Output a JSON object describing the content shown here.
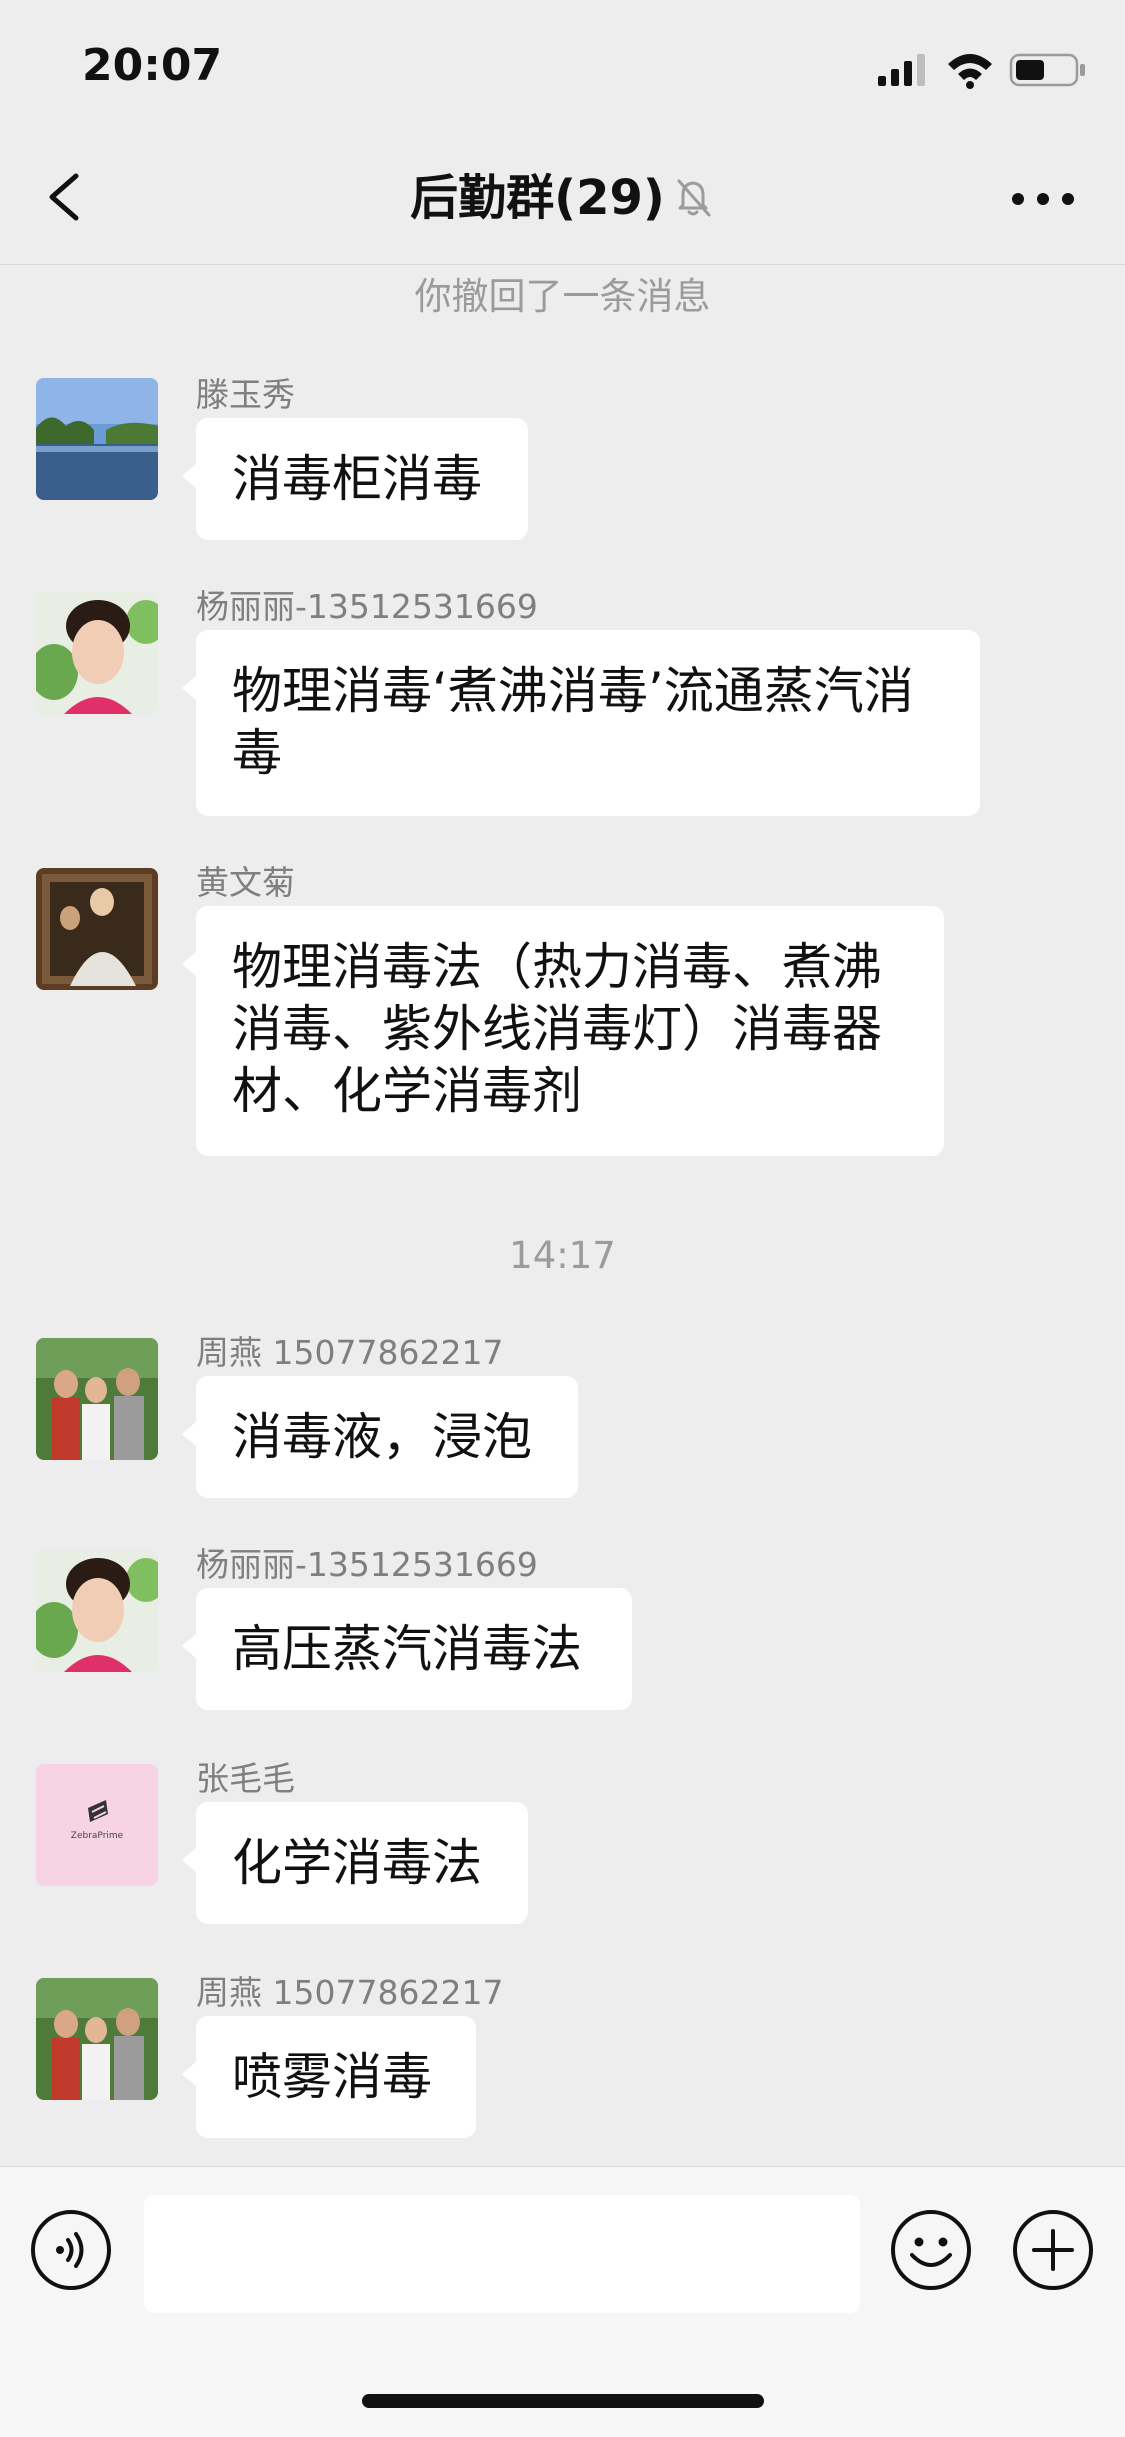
{
  "status_bar": {
    "time": "20:07"
  },
  "nav": {
    "title": "后勤群(29)"
  },
  "messages": {
    "recall_notice": "你撤回了一条消息",
    "timestamp": "14:17",
    "items": [
      {
        "sender": "滕玉秀",
        "lines": [
          "消毒柜消毒"
        ]
      },
      {
        "sender": "杨丽丽-13512531669",
        "lines": [
          "物理消毒‘煮沸消毒’流通蒸汽消",
          "毒"
        ]
      },
      {
        "sender": "黄文菊",
        "lines": [
          "物理消毒法（热力消毒、煮沸",
          "消毒、紫外线消毒灯）消毒器",
          "材、化学消毒剂"
        ]
      },
      {
        "sender": "周燕 15077862217",
        "lines": [
          "消毒液，浸泡"
        ]
      },
      {
        "sender": "杨丽丽-13512531669",
        "lines": [
          "高压蒸汽消毒法"
        ]
      },
      {
        "sender": "张毛毛",
        "lines": [
          "化学消毒法"
        ]
      },
      {
        "sender": "周燕 15077862217",
        "lines": [
          "喷雾消毒"
        ]
      }
    ]
  },
  "icons": {
    "back": "chevron-left-icon",
    "mute": "bell-slash-icon",
    "more": "more-dots-icon",
    "voice": "voice-icon",
    "emoji": "emoji-icon",
    "plus": "plus-icon"
  },
  "avatar_logo_text": "ZebraPrime"
}
